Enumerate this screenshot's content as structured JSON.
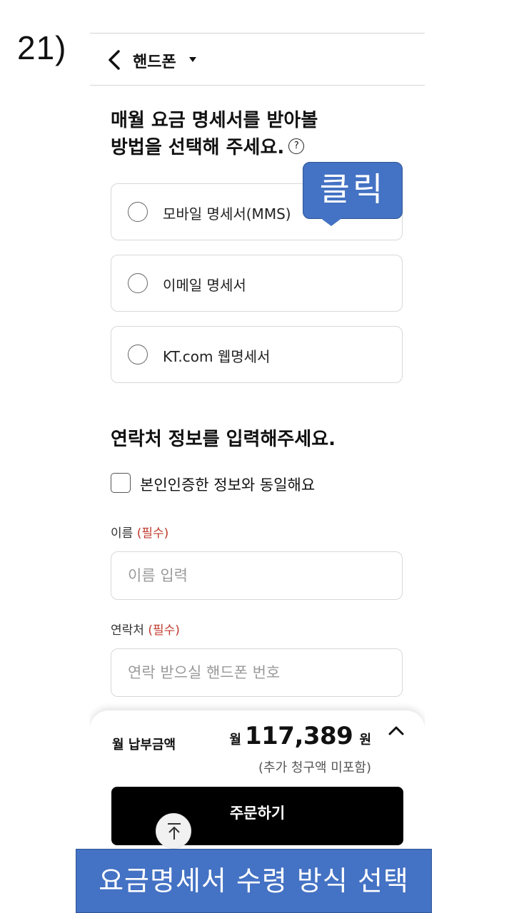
{
  "step_label": "21)",
  "header": {
    "title": "핸드폰"
  },
  "billing": {
    "title_line1": "매월 요금 명세서를 받아볼",
    "title_line2": "방법을 선택해 주세요.",
    "help_glyph": "?",
    "options": [
      {
        "label": "모바일 명세서(MMS)"
      },
      {
        "label": "이메일 명세서"
      },
      {
        "label": "KT.com 웹명세서"
      }
    ]
  },
  "contact": {
    "title": "연락처 정보를 입력해주세요.",
    "same_as_verified_label": "본인인증한 정보와 동일해요",
    "name_label": "이름",
    "name_required": "(필수)",
    "name_placeholder": "이름 입력",
    "phone_label": "연락처",
    "phone_required": "(필수)",
    "phone_placeholder": "연락 받으실 핸드폰 번호"
  },
  "summary": {
    "monthly_payment_label": "월 납부금액",
    "currency_prefix": "월",
    "amount": "117,389",
    "currency_suffix": "원",
    "note": "(추가 청구액 미포함)",
    "order_button": "주문하기"
  },
  "annotation": {
    "callout": "클릭",
    "caption": "요금명세서 수령 방식 선택",
    "accent_color": "#4472c4"
  }
}
